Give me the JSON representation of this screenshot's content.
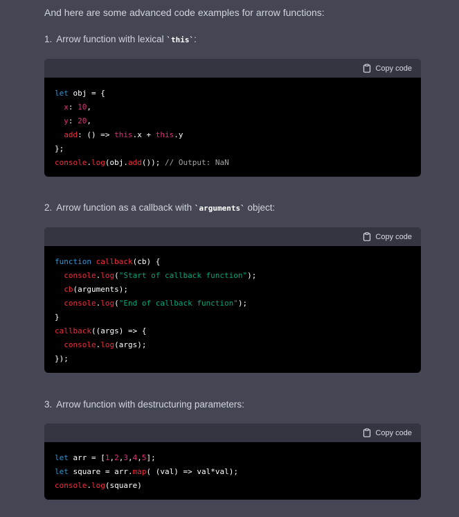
{
  "intro": "And here are some advanced code examples for arrow functions:",
  "copy_label": "Copy code",
  "items": [
    {
      "number": "1.",
      "title_before": "Arrow function with lexical ",
      "title_code": "`this`",
      "title_after": ":",
      "code_lines": [
        "let obj = {",
        "  x: 10,",
        "  y: 20,",
        "  add: () => this.x + this.y",
        "};",
        "console.log(obj.add()); // Output: NaN"
      ]
    },
    {
      "number": "2.",
      "title_before": "Arrow function as a callback with ",
      "title_code": "`arguments`",
      "title_after": " object:",
      "code_lines": [
        "function callback(cb) {",
        "  console.log(\"Start of callback function\");",
        "  cb(arguments);",
        "  console.log(\"End of callback function\");",
        "}",
        "callback((args) => {",
        "  console.log(args);",
        "});"
      ]
    },
    {
      "number": "3.",
      "title_before": "Arrow function with destructuring parameters:",
      "title_code": "",
      "title_after": "",
      "code_lines": [
        "let arr = [1,2,3,4,5];",
        "let square = arr.map( (val) => val*val);",
        "console.log(square)"
      ]
    }
  ],
  "colors": {
    "background": "#444654",
    "code_background": "#000000",
    "code_header": "#343541",
    "keyword": "#2e95d3",
    "number": "#df3079",
    "function": "#f22c3d",
    "string": "#00a67d"
  }
}
